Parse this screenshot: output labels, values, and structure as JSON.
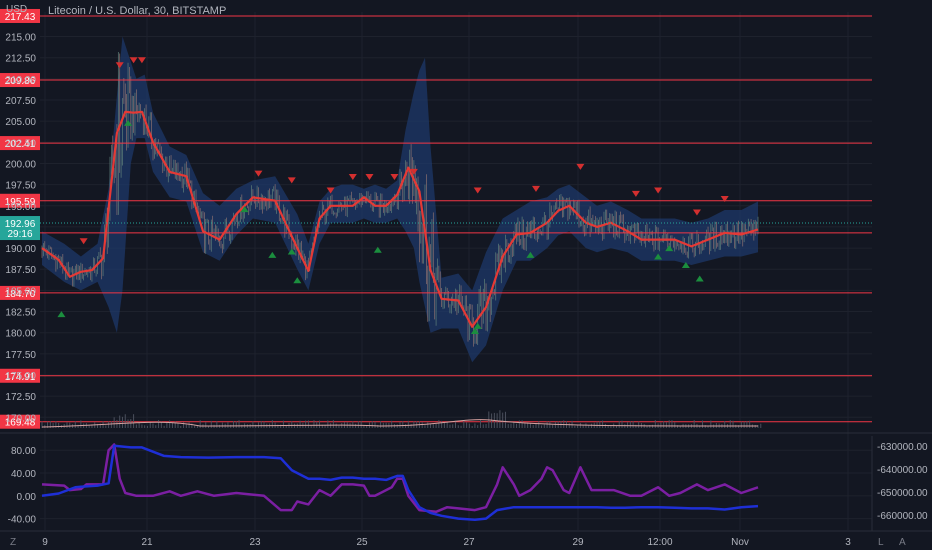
{
  "header": {
    "currency": "USD",
    "symbol_title": "Litecoin / U.S. Dollar, 30, BITSTAMP"
  },
  "footer": {
    "timezone_toggle": "Z",
    "log_toggle": "L",
    "auto_toggle": "A"
  },
  "colors": {
    "background": "#131722",
    "grid": "#1e222d",
    "level_line": "#f23645",
    "level_label_bg": "#f23645",
    "band_fill": "#1e3a6e",
    "ma_line": "#e53935",
    "buy_marker": "#1b8e3e",
    "sell_marker": "#d32f2f",
    "current_price_bg": "#26a69a",
    "osc_purple": "#7b1fa2",
    "osc_blue": "#1e2fd6"
  },
  "chart_data": [
    {
      "type": "line",
      "title": "Litecoin / U.S. Dollar, 30, BITSTAMP",
      "x_ticks": [
        "9",
        "21",
        "23",
        "25",
        "27",
        "29",
        "12:00",
        "Nov",
        "3"
      ],
      "y_ticks": [
        215.0,
        212.5,
        210.0,
        207.5,
        205.0,
        202.5,
        200.0,
        197.5,
        195.0,
        192.5,
        190.0,
        187.5,
        185.0,
        182.5,
        180.0,
        177.5,
        175.0,
        172.5,
        170.0
      ],
      "y_tick_labels": [
        "215.00",
        "212.50",
        "210.00",
        "207.50",
        "205.00",
        "202.50",
        "200.00",
        "197.50",
        "195.00",
        "192.50",
        "190.00",
        "187.50",
        "185.00",
        "182.50",
        "180.00",
        "177.50",
        "175.00",
        "172.50",
        "170.00"
      ],
      "ylim": [
        168.5,
        217.9
      ],
      "grid": true,
      "current_price": 192.96,
      "current_price_label": "192.96",
      "countdown_label": "29:16",
      "levels": [
        217.43,
        209.86,
        202.41,
        195.59,
        191.8,
        184.7,
        174.91,
        169.48
      ],
      "level_labels": [
        "217.43",
        "209.86",
        "202.41",
        "195.59",
        "191.80",
        "184.70",
        "174.91",
        "169.48"
      ],
      "series": [
        {
          "kind": "moving_average",
          "x": [
            0,
            6,
            10,
            14,
            18,
            22,
            27,
            30,
            33,
            36,
            40,
            46,
            52,
            58,
            64,
            70,
            76,
            84,
            92,
            96,
            100,
            104,
            108,
            112,
            116,
            120,
            124,
            128,
            132,
            136,
            140,
            144,
            150,
            155,
            160,
            166,
            171,
            176,
            182,
            186,
            190,
            196,
            200,
            205,
            211,
            216,
            222,
            228,
            234,
            240,
            246,
            252,
            258
          ],
          "values": [
            190.0,
            188.6,
            186.6,
            187.2,
            187.4,
            188.8,
            203.6,
            206.1,
            206.0,
            206.1,
            202.5,
            199.0,
            198.5,
            192.0,
            191.0,
            194.0,
            196.0,
            195.6,
            190.0,
            187.3,
            193.5,
            195.0,
            195.0,
            195.0,
            196.0,
            195.0,
            195.0,
            196.3,
            199.5,
            196.7,
            187.4,
            184.0,
            183.8,
            180.7,
            183.0,
            189.0,
            191.6,
            191.8,
            193.0,
            194.4,
            195.0,
            193.0,
            192.5,
            193.0,
            192.0,
            191.0,
            191.0,
            191.0,
            190.2,
            191.0,
            191.8,
            191.6,
            192.2
          ]
        },
        {
          "kind": "band_upper",
          "x": [
            0,
            8,
            14,
            20,
            24,
            27,
            29,
            32,
            34,
            37,
            40,
            46,
            52,
            58,
            64,
            70,
            76,
            84,
            92,
            96,
            100,
            104,
            108,
            112,
            116,
            120,
            124,
            128,
            131,
            134,
            136,
            138,
            140,
            144,
            150,
            155,
            160,
            166,
            171,
            176,
            182,
            186,
            190,
            196,
            200,
            205,
            211,
            216,
            222,
            228,
            234,
            240,
            246,
            252,
            258
          ],
          "values": [
            192.0,
            190.5,
            189.0,
            190.5,
            197.0,
            208.0,
            215.0,
            212.0,
            210.0,
            210.5,
            206.0,
            202.0,
            201.0,
            196.5,
            195.0,
            197.0,
            198.0,
            198.5,
            194.0,
            190.5,
            195.5,
            197.0,
            197.5,
            197.5,
            197.0,
            197.5,
            197.0,
            198.0,
            204.0,
            208.5,
            211.0,
            212.5,
            202.0,
            186.5,
            187.0,
            185.0,
            189.5,
            193.5,
            194.5,
            195.5,
            196.0,
            197.0,
            197.5,
            196.0,
            195.0,
            195.5,
            194.5,
            193.5,
            193.5,
            193.5,
            193.0,
            193.5,
            194.5,
            194.5,
            195.5
          ]
        },
        {
          "kind": "band_lower",
          "x": [
            0,
            8,
            14,
            20,
            24,
            27,
            29,
            32,
            34,
            37,
            40,
            46,
            52,
            58,
            64,
            70,
            76,
            84,
            92,
            96,
            100,
            104,
            108,
            112,
            116,
            120,
            124,
            128,
            131,
            134,
            136,
            138,
            140,
            144,
            150,
            155,
            160,
            166,
            171,
            176,
            182,
            186,
            190,
            196,
            200,
            205,
            211,
            216,
            222,
            228,
            234,
            240,
            246,
            252,
            258
          ],
          "values": [
            188.0,
            186.0,
            185.0,
            186.0,
            183.0,
            180.0,
            185.0,
            200.0,
            203.0,
            203.0,
            199.0,
            196.0,
            195.5,
            189.5,
            188.5,
            191.5,
            193.5,
            193.0,
            187.5,
            185.0,
            190.5,
            193.0,
            193.0,
            193.0,
            193.5,
            193.0,
            193.0,
            193.5,
            192.0,
            190.0,
            186.0,
            183.0,
            180.0,
            180.5,
            180.5,
            176.5,
            178.5,
            185.0,
            188.5,
            188.5,
            190.0,
            191.5,
            192.0,
            190.0,
            189.5,
            190.0,
            189.5,
            188.5,
            188.5,
            188.5,
            188.0,
            188.5,
            189.0,
            189.0,
            189.5
          ]
        },
        {
          "kind": "sell_signals",
          "x": [
            15,
            28,
            33,
            36,
            78,
            90,
            104,
            112,
            118,
            127,
            134,
            157,
            178,
            194,
            214,
            222,
            236,
            246
          ],
          "values": [
            190.8,
            211.6,
            212.2,
            212.2,
            198.8,
            198.0,
            196.8,
            198.4,
            198.4,
            198.4,
            199.0,
            196.8,
            197.0,
            199.6,
            196.4,
            196.8,
            194.2,
            195.8
          ]
        },
        {
          "kind": "buy_signals",
          "x": [
            7,
            31,
            73,
            83,
            90,
            92,
            121,
            157,
            156,
            176,
            222,
            226,
            232,
            237
          ],
          "values": [
            182.2,
            204.8,
            194.6,
            189.2,
            189.6,
            186.2,
            189.8,
            180.8,
            180.2,
            189.2,
            189.0,
            190.0,
            188.0,
            186.4
          ]
        }
      ]
    },
    {
      "type": "line",
      "y_ticks": [
        80.0,
        40.0,
        0.0,
        -40.0
      ],
      "y_tick_labels": [
        "80.00",
        "40.00",
        "0.00",
        "-40.00"
      ],
      "ylim": [
        -60,
        105
      ],
      "right_axis_ticks": [
        -630000.0,
        -640000.0,
        -650000.0,
        -660000.0
      ],
      "right_axis_labels": [
        "-630000.00",
        "-640000.00",
        "-650000.00",
        "-660000.00"
      ],
      "grid": true,
      "series": [
        {
          "kind": "oscillator_purple",
          "x": [
            0,
            8,
            10,
            14,
            16,
            22,
            24,
            26,
            28,
            30,
            34,
            40,
            46,
            50,
            56,
            62,
            70,
            80,
            86,
            90,
            92,
            96,
            100,
            104,
            108,
            112,
            116,
            118,
            120,
            126,
            128,
            130,
            132,
            136,
            142,
            146,
            150,
            156,
            160,
            164,
            166,
            170,
            172,
            176,
            180,
            182,
            184,
            188,
            190,
            194,
            198,
            206,
            212,
            216,
            222,
            226,
            230,
            236,
            240,
            246,
            252,
            258
          ],
          "values": [
            20,
            18,
            10,
            12,
            20,
            20,
            80,
            90,
            30,
            5,
            0,
            0,
            8,
            0,
            8,
            0,
            5,
            0,
            -25,
            -25,
            -10,
            -15,
            10,
            0,
            20,
            20,
            18,
            0,
            0,
            15,
            30,
            30,
            0,
            -25,
            -28,
            -20,
            -22,
            -25,
            -20,
            20,
            50,
            20,
            0,
            10,
            30,
            50,
            45,
            10,
            5,
            50,
            10,
            10,
            0,
            0,
            15,
            0,
            5,
            20,
            10,
            20,
            5,
            15
          ]
        },
        {
          "kind": "oscillator_blue",
          "x": [
            0,
            6,
            12,
            14,
            20,
            24,
            26,
            32,
            36,
            44,
            50,
            60,
            70,
            80,
            86,
            90,
            96,
            100,
            104,
            108,
            112,
            116,
            120,
            124,
            128,
            130,
            132,
            136,
            140,
            144,
            150,
            156,
            160,
            164,
            170,
            176,
            182,
            186,
            190,
            196,
            200,
            205,
            210,
            216,
            222,
            228,
            234,
            240,
            246,
            252,
            258
          ],
          "values": [
            0,
            4,
            15,
            16,
            18,
            22,
            88,
            85,
            85,
            70,
            68,
            67,
            68,
            68,
            66,
            45,
            30,
            30,
            28,
            32,
            32,
            30,
            30,
            28,
            35,
            35,
            10,
            -20,
            -30,
            -35,
            -40,
            -42,
            -40,
            -25,
            -20,
            -20,
            -20,
            -20,
            -20,
            -20,
            -20,
            -21,
            -21,
            -20,
            -20,
            -21,
            -22,
            -22,
            -24,
            -20,
            -18
          ]
        }
      ]
    }
  ]
}
